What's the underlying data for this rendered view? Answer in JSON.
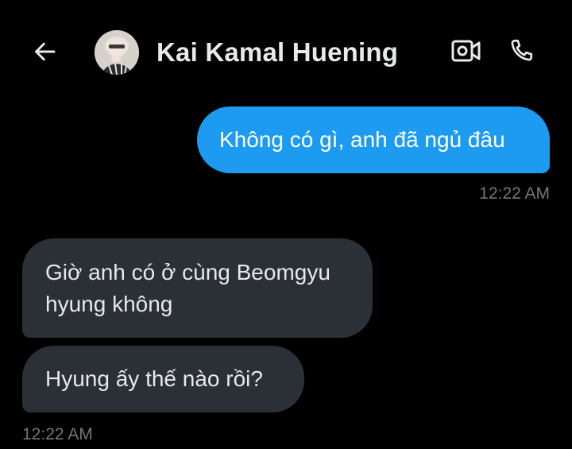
{
  "header": {
    "contact_name": "Kai Kamal Huening",
    "icons": {
      "back": "arrow-left-icon",
      "video": "video-camera-icon",
      "call": "phone-icon"
    }
  },
  "messages": [
    {
      "direction": "outgoing",
      "text": "Không có gì, anh đã ngủ đâu",
      "timestamp": "12:22 AM"
    },
    {
      "direction": "incoming",
      "text": "Giờ anh có ở cùng Beomgyu hyung không"
    },
    {
      "direction": "incoming",
      "text": "Hyung ấy thế nào rồi?",
      "timestamp": "12:22 AM"
    }
  ],
  "colors": {
    "background": "#000000",
    "outgoing_bubble": "#1d9bf0",
    "incoming_bubble": "#2a3035",
    "timestamp": "#71767b",
    "text_primary": "#e7e9ea"
  }
}
